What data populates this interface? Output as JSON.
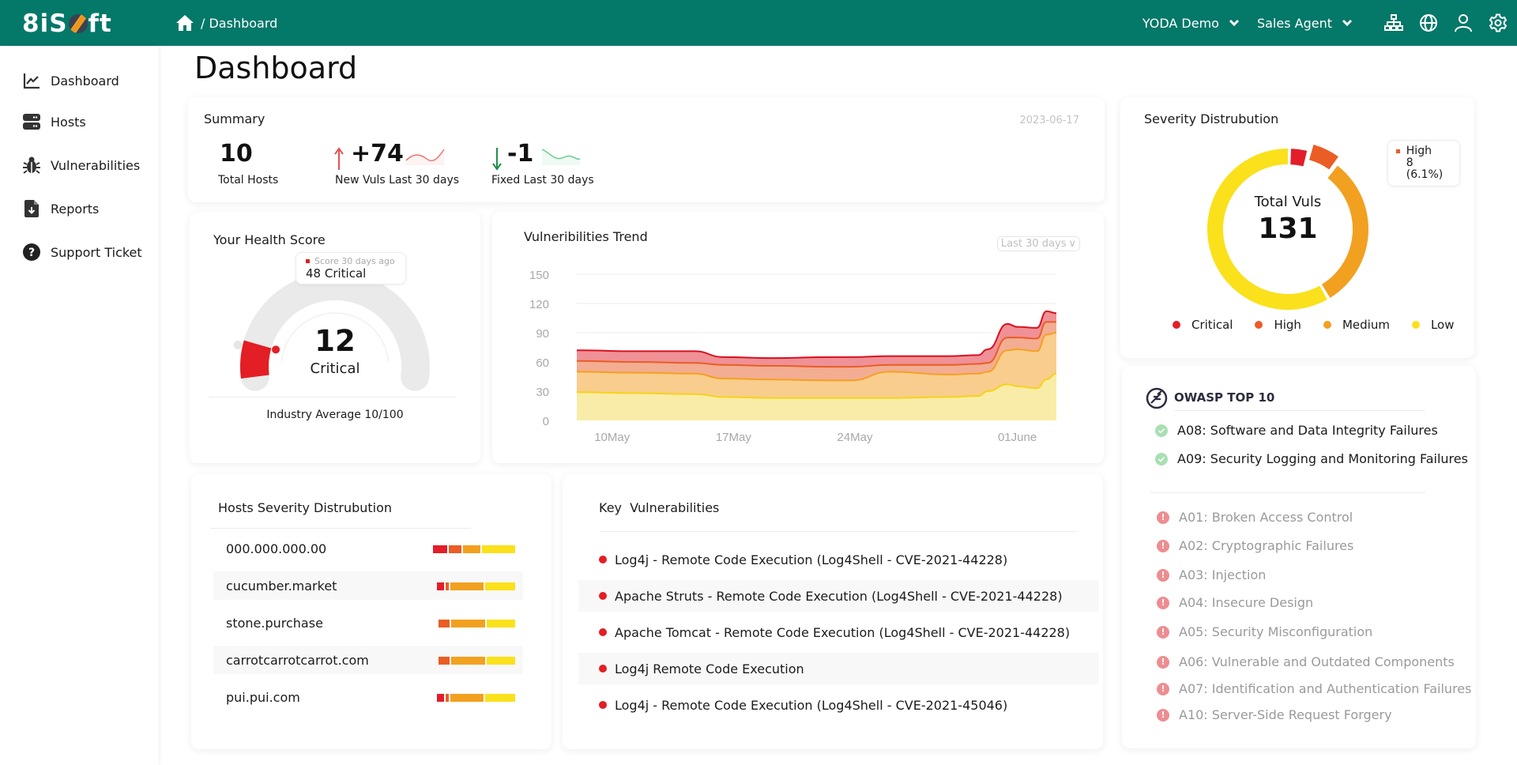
{
  "header": {
    "logo_text_left": "8iS",
    "logo_text_right": "ft",
    "breadcrumb": "/ Dashboard",
    "org_dropdown": "YODA Demo",
    "role_dropdown": "Sales Agent",
    "icons": [
      "sitemap-icon",
      "globe-icon",
      "user-icon",
      "gear-icon"
    ],
    "brand_color": "#047869"
  },
  "sidebar": {
    "items": [
      {
        "label": "Dashboard",
        "icon": "chart-line-icon"
      },
      {
        "label": "Hosts",
        "icon": "server-icon"
      },
      {
        "label": "Vulnerabilities",
        "icon": "bug-icon"
      },
      {
        "label": "Reports",
        "icon": "file-download-icon"
      },
      {
        "label": "Support Ticket",
        "icon": "question-circle-icon"
      }
    ]
  },
  "page": {
    "title": "Dashboard"
  },
  "summary": {
    "title": "Summary",
    "date": "2023-06-17",
    "stats": [
      {
        "value": "10",
        "label": "Total Hosts"
      },
      {
        "value": "+74",
        "label": "New Vuls Last 30 days",
        "trend": "up"
      },
      {
        "value": "-1",
        "label": "Fixed Last 30 days",
        "trend": "down"
      }
    ]
  },
  "health": {
    "title": "Your Health Score",
    "score": "12",
    "score_fraction": 0.12,
    "level": "Critical",
    "tooltip_label": "Score 30 days ago",
    "tooltip_value": "48 Critical",
    "previous_score_fraction": 0.48,
    "industry": "Industry Average 10/100"
  },
  "trend": {
    "title": "Vulneribilities Trend",
    "range_dropdown": "Last 30 days",
    "range_chevron": "∨"
  },
  "chart_data": [
    {
      "type": "area",
      "title": "Vulneribilities Trend",
      "stacked": true,
      "ylim": [
        0,
        150
      ],
      "yticks": [
        0,
        30,
        60,
        90,
        120,
        150
      ],
      "xticks": [
        "10May",
        "17May",
        "24May",
        "01June"
      ],
      "x": [
        0,
        3,
        6,
        7.5,
        10,
        13,
        14,
        16,
        19,
        20.5,
        21,
        22,
        22.5,
        23.5,
        24,
        24.5
      ],
      "series": [
        {
          "name": "Low",
          "color": "#f9e04b",
          "values": [
            29,
            28,
            27,
            24,
            23,
            23,
            23,
            23,
            24,
            25,
            30,
            37,
            35,
            33,
            42,
            48
          ]
        },
        {
          "name": "Medium",
          "color": "#f5a623",
          "values": [
            21,
            21,
            21,
            19,
            19,
            18,
            18,
            27,
            23,
            23,
            20,
            35,
            38,
            38,
            46,
            42
          ]
        },
        {
          "name": "High",
          "color": "#ea6128",
          "values": [
            11,
            11,
            11,
            14,
            14,
            14,
            14,
            7,
            10,
            10,
            9,
            13,
            12,
            13,
            13,
            11
          ]
        },
        {
          "name": "Critical",
          "color": "#e0141e",
          "values": [
            11,
            11,
            12,
            8,
            8,
            10,
            10,
            9,
            9,
            9,
            14,
            14,
            11,
            11,
            11,
            9
          ]
        }
      ]
    },
    {
      "type": "pie",
      "title": "Severity Distrubution",
      "center_label": "Total Vuls",
      "total": 131,
      "categories": [
        "Critical",
        "High",
        "Medium",
        "Low"
      ],
      "values": [
        5,
        8,
        41,
        77
      ],
      "colors": [
        "#e31e2a",
        "#ea5d25",
        "#f2a020",
        "#fae11c"
      ],
      "tooltip": {
        "label": "High",
        "value": "8 (6.1%)"
      },
      "legend": "bottom"
    }
  ],
  "severity": {
    "title": "Severity Distrubution",
    "center_label": "Total Vuls",
    "total": "131",
    "tooltip_label": "High",
    "tooltip_value": "8 (6.1%)",
    "legend": [
      "Critical",
      "High",
      "Medium",
      "Low"
    ]
  },
  "owasp": {
    "title": "OWASP TOP 10",
    "passed": [
      "A08: Software and Data Integrity Failures",
      "A09: Security Logging and Monitoring Failures"
    ],
    "failed": [
      "A01: Broken Access Control",
      "A02: Cryptographic Failures",
      "A03: Injection",
      "A04: Insecure Design",
      "A05: Security Misconfiguration",
      "A06: Vulnerable and Outdated Components",
      "A07: Identification and Authentication Failures",
      "A10: Server-Side Request Forgery"
    ]
  },
  "hosts": {
    "title": "Hosts Severity Distrubution",
    "rows": [
      {
        "name": "000.000.000.00",
        "dist": [
          18,
          16,
          22,
          42
        ]
      },
      {
        "name": "cucumber.market",
        "dist": [
          9,
          4,
          42,
          38
        ]
      },
      {
        "name": "stone.purchase",
        "dist": [
          0,
          14,
          43,
          36
        ]
      },
      {
        "name": "carrotcarrotcarrot.com",
        "dist": [
          0,
          14,
          43,
          36
        ]
      },
      {
        "name": "pui.pui.com",
        "dist": [
          9,
          4,
          42,
          38
        ]
      }
    ]
  },
  "key_vulns": {
    "title": "Key  Vulnerabilities",
    "items": [
      "Log4j - Remote Code Execution (Log4Shell - CVE-2021-44228)",
      "Apache Struts - Remote Code Execution (Log4Shell - CVE-2021-44228)",
      "Apache Tomcat - Remote Code Execution (Log4Shell - CVE-2021-44228)",
      "Log4j Remote Code Execution",
      "Log4j - Remote Code Execution (Log4Shell - CVE-2021-45046)"
    ]
  }
}
